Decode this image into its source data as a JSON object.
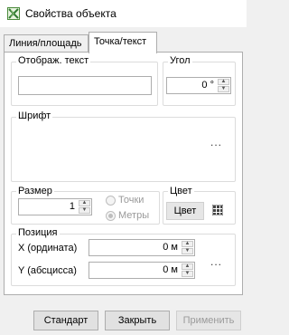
{
  "window": {
    "title": "Свойства объекта",
    "icon": "map-layer-icon"
  },
  "tabs": [
    {
      "label": "Линия/площадь",
      "active": false
    },
    {
      "label": "Точка/текст",
      "active": true
    }
  ],
  "display_text": {
    "legend": "Отображ. текст",
    "value": ""
  },
  "angle": {
    "legend": "Угол",
    "value": "0 °"
  },
  "font": {
    "legend": "Шрифт",
    "more": "..."
  },
  "size": {
    "legend": "Размер",
    "value": "1",
    "options": [
      {
        "label": "Точки",
        "selected": false
      },
      {
        "label": "Метры",
        "selected": true
      }
    ]
  },
  "color": {
    "legend": "Цвет",
    "button": "Цвет",
    "icon": "color-palette-icon"
  },
  "position": {
    "legend": "Позиция",
    "y_label": "X (ордината)",
    "y_value": "0 м",
    "x_label": "Y (абсцисса)",
    "x_value": "0 м",
    "more": "..."
  },
  "buttons": {
    "default": "Стандарт",
    "close": "Закрыть",
    "apply": "Применить"
  },
  "colors": {
    "panel": "#ffffff",
    "window_bg": "#f0f0f0",
    "border": "#adadad",
    "disabled": "#9a9a9a"
  }
}
